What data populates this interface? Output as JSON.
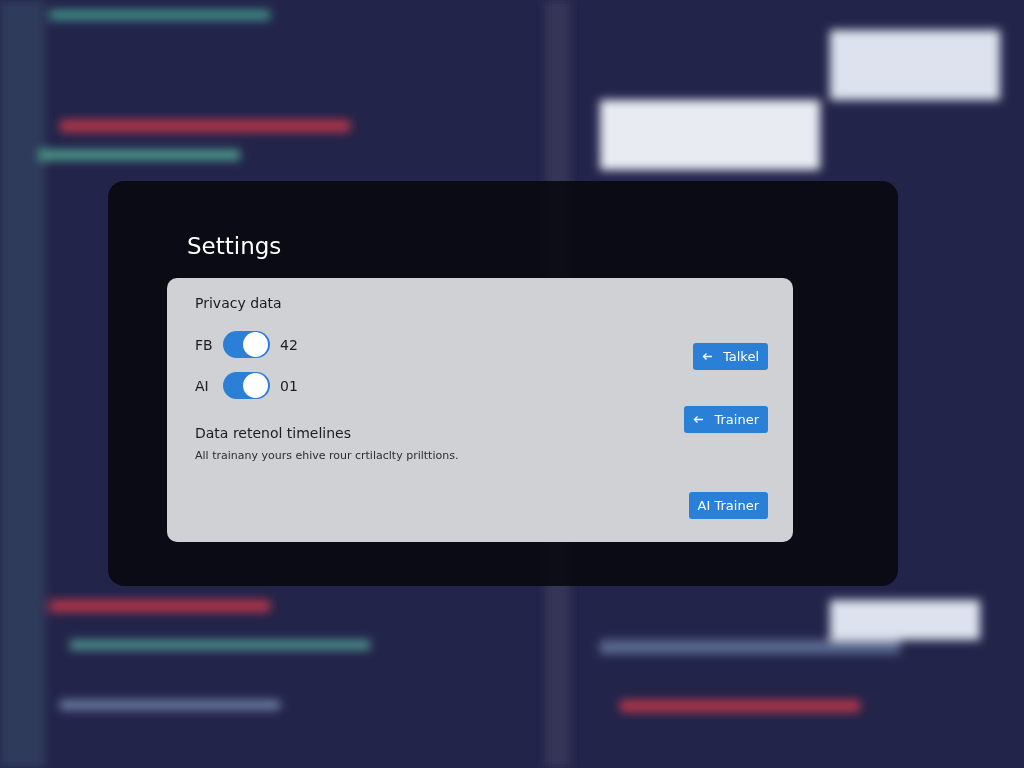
{
  "dialog": {
    "title": "Settings"
  },
  "privacy": {
    "heading": "Privacy data",
    "items": [
      {
        "label": "FB",
        "on": true,
        "count": "42"
      },
      {
        "label": "AI",
        "on": true,
        "count": "01"
      }
    ]
  },
  "retention": {
    "heading": "Data retenol timelines",
    "description": "All trainany yours ehive rour crtilaclty prilttions."
  },
  "buttons": [
    {
      "label": "Talkel",
      "kind": "back"
    },
    {
      "label": "Trainer",
      "kind": "back"
    },
    {
      "label": "AI Trainer",
      "kind": "plain"
    }
  ]
}
